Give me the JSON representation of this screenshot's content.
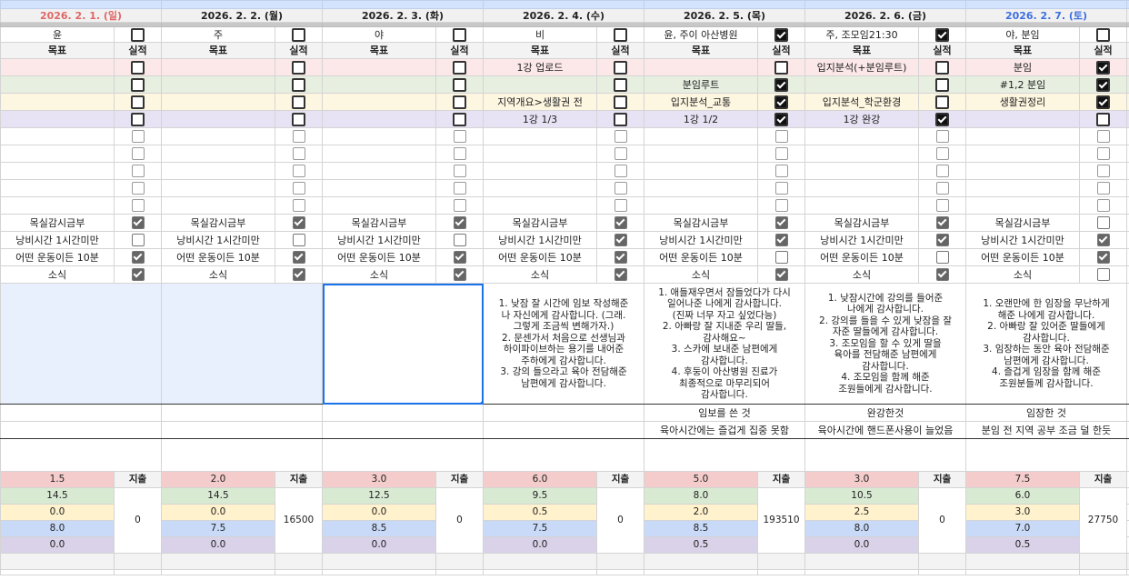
{
  "labels": {
    "goal": "목표",
    "result": "실적",
    "expense": "지출"
  },
  "colors": {
    "sunday": "#e06666",
    "saturday": "#3d6fe0",
    "stat_rows": [
      "#f4cccc",
      "#d9ead3",
      "#fff2cc",
      "#c9daf8",
      "#d9d2e9"
    ],
    "selection": "#1a73e8"
  },
  "days": [
    {
      "date": "2026. 2. 1. (일)",
      "kind": "sunday",
      "event": "윤",
      "event_checked": false,
      "goals": [
        {
          "text": "",
          "checked": false
        },
        {
          "text": "",
          "checked": false
        },
        {
          "text": "",
          "checked": false
        },
        {
          "text": "",
          "checked": false
        }
      ],
      "habits": [
        {
          "label": "목실감시금부",
          "checked": true
        },
        {
          "label": "낭비시간 1시간미만",
          "checked": false
        },
        {
          "label": "어떤 운동이든 10분",
          "checked": true
        },
        {
          "label": "소식",
          "checked": true
        }
      ],
      "gratitude": "",
      "achievement": "",
      "reflection": "",
      "stats": [
        "1.5",
        "14.5",
        "0.0",
        "8.0",
        "0.0"
      ],
      "expense": "0"
    },
    {
      "date": "2026. 2. 2. (월)",
      "kind": "weekday",
      "event": "주",
      "event_checked": false,
      "goals": [
        {
          "text": "",
          "checked": false
        },
        {
          "text": "",
          "checked": false
        },
        {
          "text": "",
          "checked": false
        },
        {
          "text": "",
          "checked": false
        }
      ],
      "habits": [
        {
          "label": "목실감시금부",
          "checked": true
        },
        {
          "label": "낭비시간 1시간미만",
          "checked": false
        },
        {
          "label": "어떤 운동이든 10분",
          "checked": true
        },
        {
          "label": "소식",
          "checked": true
        }
      ],
      "gratitude": "",
      "achievement": "",
      "reflection": "",
      "stats": [
        "2.0",
        "14.5",
        "0.0",
        "7.5",
        "0.0"
      ],
      "expense": "16500"
    },
    {
      "date": "2026. 2. 3. (화)",
      "kind": "weekday",
      "event": "야",
      "event_checked": false,
      "goals": [
        {
          "text": "",
          "checked": false
        },
        {
          "text": "",
          "checked": false
        },
        {
          "text": "",
          "checked": false
        },
        {
          "text": "",
          "checked": false
        }
      ],
      "habits": [
        {
          "label": "목실감시금부",
          "checked": true
        },
        {
          "label": "낭비시간 1시간미만",
          "checked": false
        },
        {
          "label": "어떤 운동이든 10분",
          "checked": true
        },
        {
          "label": "소식",
          "checked": true
        }
      ],
      "gratitude": "",
      "achievement": "",
      "reflection": "",
      "stats": [
        "3.0",
        "12.5",
        "0.0",
        "8.5",
        "0.0"
      ],
      "expense": "0"
    },
    {
      "date": "2026. 2. 4. (수)",
      "kind": "weekday",
      "event": "비",
      "event_checked": false,
      "goals": [
        {
          "text": "1강 업로드",
          "checked": false
        },
        {
          "text": "",
          "checked": false
        },
        {
          "text": "지역개요>생활권 전",
          "checked": false
        },
        {
          "text": "1강 1/3",
          "checked": false
        }
      ],
      "habits": [
        {
          "label": "목실감시금부",
          "checked": true
        },
        {
          "label": "낭비시간 1시간미만",
          "checked": true
        },
        {
          "label": "어떤 운동이든 10분",
          "checked": true
        },
        {
          "label": "소식",
          "checked": true
        }
      ],
      "gratitude": "1. 낮잠 잘 시간에 임보 작성해준\n나 자신에게 감사합니다. (그래.\n그렇게 조금씩 변해가자.)\n2. 문센가서 처음으로 선생님과\n하이파이브하는 용기를 내어준\n주하에게 감사합니다.\n3. 강의 들으라고 육아 전담해준\n남편에게 감사합니다.",
      "achievement": "",
      "reflection": "",
      "stats": [
        "6.0",
        "9.5",
        "0.5",
        "7.5",
        "0.0"
      ],
      "expense": "0"
    },
    {
      "date": "2026. 2. 5. (목)",
      "kind": "weekday",
      "event": "윤, 주이 아산병원",
      "event_checked": true,
      "goals": [
        {
          "text": "",
          "checked": false
        },
        {
          "text": "분임루트",
          "checked": true
        },
        {
          "text": "입지분석_교통",
          "checked": true
        },
        {
          "text": "1강 1/2",
          "checked": true
        }
      ],
      "habits": [
        {
          "label": "목실감시금부",
          "checked": true
        },
        {
          "label": "낭비시간 1시간미만",
          "checked": true
        },
        {
          "label": "어떤 운동이든 10분",
          "checked": false
        },
        {
          "label": "소식",
          "checked": true
        }
      ],
      "gratitude": "1. 애들재우면서 잠들었다가 다시\n일어나준 나에게 감사합니다.\n(진짜 너무 자고 싶었다능)\n2. 아빠랑 잘 지내준 우리 딸들,\n감사해요~\n3. 스카에 보내준 남편에게\n감사합니다.\n4. 후둥이 아산병원 진료가\n최종적으로 마무리되어\n감사합니다.",
      "achievement": "임보를 쓴 것",
      "reflection": "육아시간에는 즐겁게 집중 못함",
      "stats": [
        "5.0",
        "8.0",
        "2.0",
        "8.5",
        "0.5"
      ],
      "expense": "193510"
    },
    {
      "date": "2026. 2. 6. (금)",
      "kind": "weekday",
      "event": "주, 조모임21:30",
      "event_checked": true,
      "goals": [
        {
          "text": "입지분석(+분임루트)",
          "checked": false
        },
        {
          "text": "",
          "checked": false
        },
        {
          "text": "입지분석_학군환경",
          "checked": false
        },
        {
          "text": "1강 완강",
          "checked": true
        }
      ],
      "habits": [
        {
          "label": "목실감시금부",
          "checked": true
        },
        {
          "label": "낭비시간 1시간미만",
          "checked": true
        },
        {
          "label": "어떤 운동이든 10분",
          "checked": false
        },
        {
          "label": "소식",
          "checked": true
        }
      ],
      "gratitude": "1. 낮잠시간에 강의를 들어준\n나에게 감사합니다.\n2. 강의를 들을 수 있게 낮잠을 잘\n자준 딸들에게 감사합니다.\n3. 조모임을 할 수 있게 딸을\n육아를 전담해준 남편에게\n감사합니다.\n4. 조모임을 함께 해준\n조원들에게 감사합니다.",
      "achievement": "완강한것",
      "reflection": "육아시간에 핸드폰사용이 늘었음",
      "stats": [
        "3.0",
        "10.5",
        "2.5",
        "8.0",
        "0.0"
      ],
      "expense": "0"
    },
    {
      "date": "2026. 2. 7. (토)",
      "kind": "saturday",
      "event": "야, 분임",
      "event_checked": false,
      "goals": [
        {
          "text": "분임",
          "checked": true
        },
        {
          "text": "#1,2 분임",
          "checked": true
        },
        {
          "text": "생활권정리",
          "checked": true
        },
        {
          "text": "",
          "checked": false
        }
      ],
      "habits": [
        {
          "label": "목실감시금부",
          "checked": false
        },
        {
          "label": "낭비시간 1시간미만",
          "checked": true
        },
        {
          "label": "어떤 운동이든 10분",
          "checked": true
        },
        {
          "label": "소식",
          "checked": false
        }
      ],
      "gratitude": "1. 오랜만에 한 임장을 무난하게\n해준 나에게 감사합니다.\n2. 아빠랑 잘 있어준 딸들에게\n감사합니다.\n3. 임장하는 동안 육아 전담해준\n남편에게 감사합니다.\n4. 즐겁게 임장을 함께 해준\n조원분들께 감사합니다.",
      "achievement": "임장한 것",
      "reflection": "분임 전 지역 공부 조금 덜 한듯",
      "stats": [
        "7.5",
        "6.0",
        "3.0",
        "7.0",
        "0.5"
      ],
      "expense": "27750"
    }
  ]
}
